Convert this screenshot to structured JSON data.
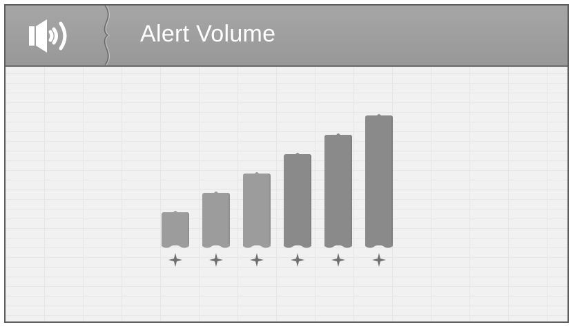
{
  "header": {
    "title": "Alert Volume",
    "icon": "speaker-icon"
  },
  "volume": {
    "levels": 6,
    "selected_level": 6,
    "bar_color": "#8a8a8a",
    "bar_color_light": "#9c9c9c"
  },
  "colors": {
    "header_bg": "#a0a0a0",
    "title_text": "#ffffff",
    "background": "#f1f1f1",
    "star": "#6e6e6e"
  }
}
